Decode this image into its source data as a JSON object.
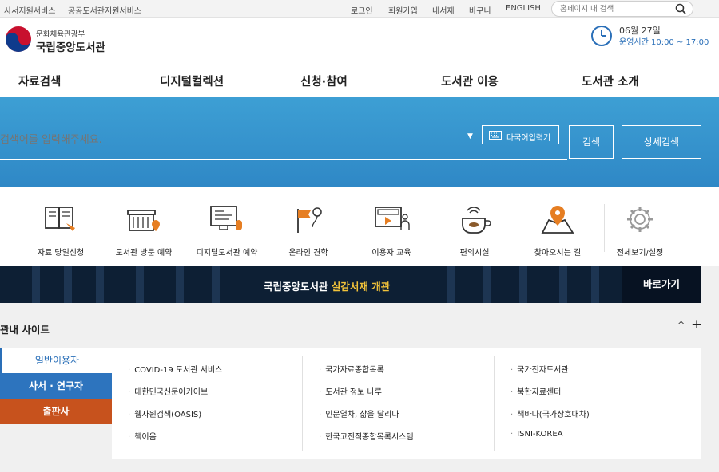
{
  "topbar": {
    "external_links": [
      "사서지원서비스",
      "공공도서관지원서비스"
    ],
    "util_links": [
      "로그인",
      "회원가입",
      "내서재",
      "바구니",
      "ENGLISH"
    ],
    "search_placeholder": "홈페이지 내 검색"
  },
  "header": {
    "ministry": "문화체육관광부",
    "library_name": "국립중앙도서관",
    "date": "06월 27일",
    "hours": "운영시간 10:00 ~ 17:00"
  },
  "gnb": [
    "자료검색",
    "디지털컬렉션",
    "신청·참여",
    "도서관 이용",
    "도서관 소개"
  ],
  "search": {
    "placeholder": "검색어를 입력해주세요.",
    "keyboard_label": "다국어입력기",
    "search_button": "검색",
    "detail_button": "상세검색"
  },
  "quick_menu": [
    {
      "label": "자료 당일신청",
      "icon": "book-request-icon"
    },
    {
      "label": "도서관 방문 예약",
      "icon": "visit-reservation-icon"
    },
    {
      "label": "디지털도서관 예약",
      "icon": "digital-library-icon"
    },
    {
      "label": "온라인 견학",
      "icon": "online-tour-icon"
    },
    {
      "label": "이용자 교육",
      "icon": "user-education-icon"
    },
    {
      "label": "편의시설",
      "icon": "convenience-icon"
    },
    {
      "label": "찾아오시는 길",
      "icon": "directions-icon"
    },
    {
      "label": "전체보기/설정",
      "icon": "gear-icon"
    }
  ],
  "banner": {
    "text_prefix": "국립중앙도서관",
    "text_highlight": "실감서재 개관",
    "button": "바로가기"
  },
  "related": {
    "title": "관내 사이트",
    "collapse_symbol": "^",
    "expand_symbol": "+",
    "tabs": [
      "일반이용자",
      "사서 · 연구자",
      "출판사"
    ],
    "columns": [
      [
        "COVID-19 도서관 서비스",
        "대한민국신문아카이브",
        "웹자원검색(OASIS)",
        "책이음"
      ],
      [
        "국가자료종합목록",
        "도서관 정보 나루",
        "인문열차, 삶을 달리다",
        "한국고전적종합목록시스템"
      ],
      [
        "국가전자도서관",
        "북한자료센터",
        "책바다(국가상호대차)",
        "ISNI-KOREA"
      ]
    ]
  },
  "colors": {
    "hero": "#3d9fd4",
    "tab_blue": "#2d74be",
    "tab_orange": "#c7521d",
    "highlight": "#f1c23a"
  }
}
